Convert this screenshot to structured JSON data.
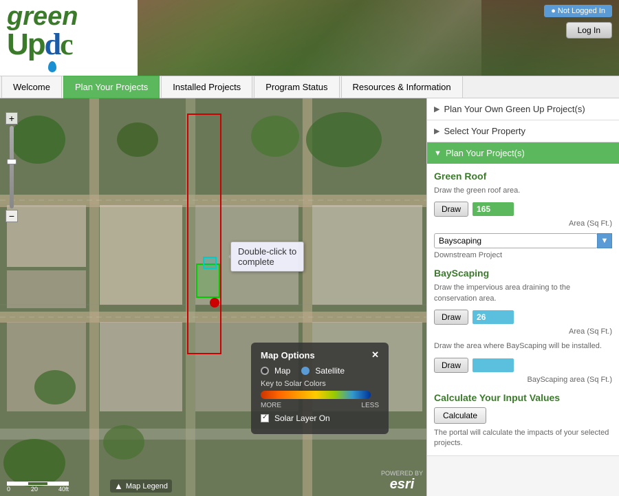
{
  "header": {
    "logo_green": "green",
    "logo_up": "Up",
    "logo_dc": "dc",
    "not_logged_in": "● Not Logged In",
    "login_label": "Log In"
  },
  "nav": {
    "tabs": [
      {
        "id": "welcome",
        "label": "Welcome",
        "active": false
      },
      {
        "id": "plan",
        "label": "Plan Your Projects",
        "active": true
      },
      {
        "id": "installed",
        "label": "Installed Projects",
        "active": false
      },
      {
        "id": "program",
        "label": "Program Status",
        "active": false
      },
      {
        "id": "resources",
        "label": "Resources & Information",
        "active": false
      }
    ]
  },
  "map": {
    "tooltip": "Double-click to\ncomplete",
    "options_title": "Map Options",
    "close_icon": "✕",
    "map_label": "Map",
    "satellite_label": "Satellite",
    "satellite_selected": true,
    "solar_title": "Key to Solar Colors",
    "solar_more": "MORE",
    "solar_less": "LESS",
    "solar_layer_label": "Solar Layer On",
    "legend_label": "Map Legend",
    "scale_labels": [
      "0",
      "20",
      "40ft"
    ],
    "esri_label": "POWERED BY",
    "esri_brand": "esri"
  },
  "right_panel": {
    "sections": [
      {
        "id": "plan-own",
        "label": "Plan Your Own Green Up Project(s)",
        "collapsed": true,
        "arrow": "▶"
      },
      {
        "id": "select-property",
        "label": "Select Your Property",
        "collapsed": true,
        "arrow": "▶"
      },
      {
        "id": "plan-projects",
        "label": "Plan Your Project(s)",
        "collapsed": false,
        "arrow": "▼",
        "is_active": true
      }
    ],
    "green_roof": {
      "title": "Green Roof",
      "desc": "Draw the green roof area.",
      "draw_label": "Draw",
      "value": "165",
      "area_label": "Area (Sq Ft.)",
      "dropdown_value": "Bayscaping",
      "dropdown_label": "Downstream Project"
    },
    "bayscaping": {
      "title": "BayScaping",
      "desc": "Draw the impervious area draining to the conservation area.",
      "draw_label": "Draw",
      "value": "26",
      "area_label": "Area (Sq Ft.)",
      "desc2": "Draw the area where BayScaping will be installed.",
      "draw2_label": "Draw",
      "area2_label": "BayScaping area (Sq Ft.)"
    },
    "calculate": {
      "title": "Calculate Your Input Values",
      "button_label": "Calculate",
      "desc": "The portal will calculate the impacts of your selected projects."
    }
  }
}
